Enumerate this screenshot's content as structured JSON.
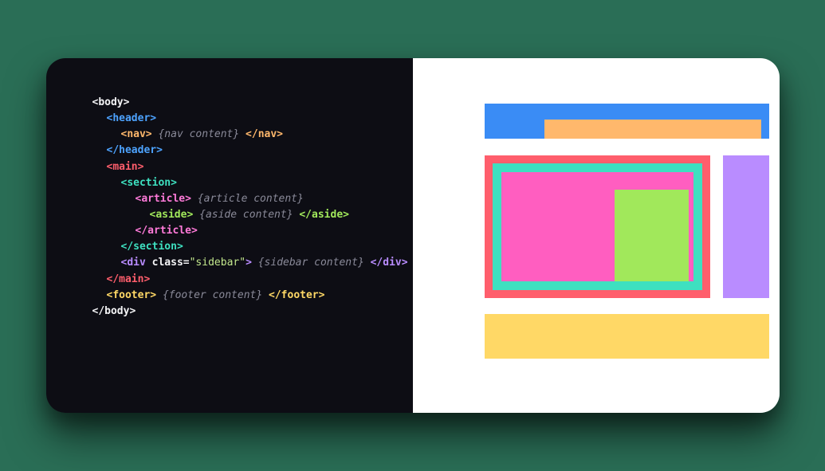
{
  "code": {
    "body_open": "<body>",
    "header_open": "<header>",
    "nav_open": "<nav>",
    "nav_content": "{nav content}",
    "nav_close": "</nav>",
    "header_close": "</header>",
    "main_open": "<main>",
    "section_open": "<section>",
    "article_open": "<article>",
    "article_content": "{article content}",
    "aside_open": "<aside>",
    "aside_content": "{aside content}",
    "aside_close": "</aside>",
    "article_close": "</article>",
    "section_close": "</section>",
    "div_open": "<div",
    "class_attr": "class=",
    "class_val": "\"sidebar\"",
    "div_open_end": ">",
    "sidebar_content": "{sidebar content}",
    "div_close": "</div>",
    "main_close": "</main>",
    "footer_open": "<footer>",
    "footer_content": "{footer content}",
    "footer_close": "</footer>",
    "body_close": "</body>"
  },
  "colors": {
    "header": "#3a8cf5",
    "nav": "#ffb86c",
    "main": "#ff5e6c",
    "section": "#3ee0c0",
    "article": "#ff5ec0",
    "aside": "#a1e85b",
    "sidebar": "#b98cff",
    "footer": "#ffd866"
  }
}
